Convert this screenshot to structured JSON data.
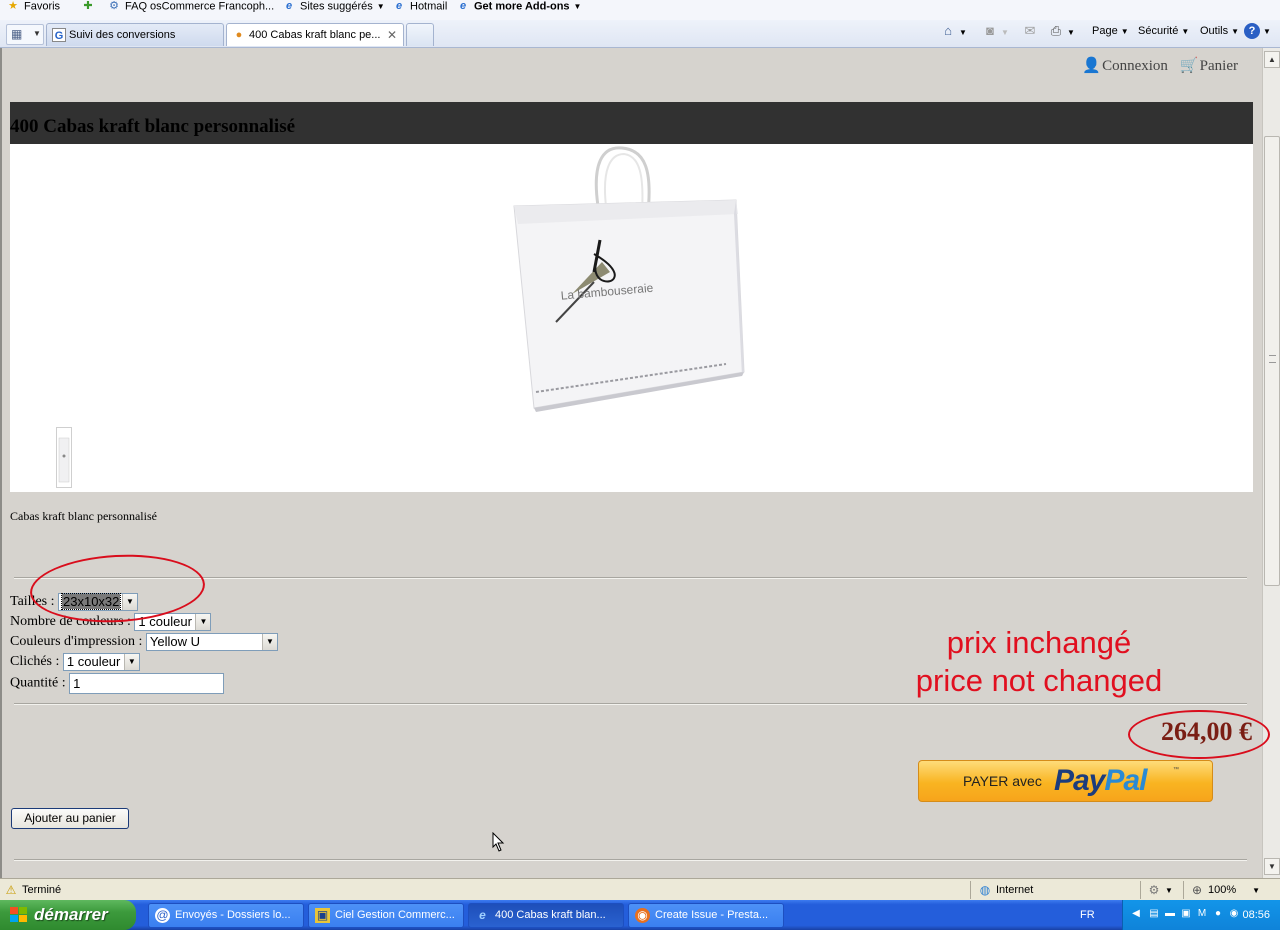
{
  "favorites_bar": {
    "items": [
      {
        "label": "Favoris",
        "icon": "star-icon"
      },
      {
        "label": "",
        "icon": "add-favorite-icon"
      },
      {
        "label": "FAQ osCommerce Francoph...",
        "icon": "link-icon"
      },
      {
        "label": "Sites suggérés",
        "icon": "ie-icon",
        "dropdown": true
      },
      {
        "label": "Hotmail",
        "icon": "ie-icon"
      },
      {
        "label": "Get more Add-ons",
        "icon": "ie-icon",
        "dropdown": true
      }
    ]
  },
  "tabs": [
    {
      "label": "Suivi des conversions",
      "icon": "google-icon",
      "active": false
    },
    {
      "label": "400 Cabas kraft blanc pe...",
      "icon": "page-icon",
      "active": true
    }
  ],
  "command_bar": {
    "page": "Page",
    "security": "Sécurité",
    "tools": "Outils"
  },
  "header_nav": {
    "login": "Connexion",
    "cart": "Panier"
  },
  "product": {
    "title": "400 Cabas kraft blanc personnalisé",
    "description": "Cabas kraft blanc personnalisé",
    "bag_text": "La bambouseraie",
    "options": [
      {
        "label": "Tailles :",
        "value": "23x10x32",
        "kind": "select"
      },
      {
        "label": "Nombre de couleurs :",
        "value": "1 couleur",
        "kind": "select"
      },
      {
        "label": "Couleurs d'impression :",
        "value": "Yellow U",
        "kind": "select"
      },
      {
        "label": "Clichés :",
        "value": "1 couleur",
        "kind": "select"
      },
      {
        "label": "Quantité :",
        "value": "1",
        "kind": "text"
      }
    ],
    "price": "264,00 €",
    "add_to_cart": "Ajouter au panier",
    "paypal": {
      "prefix": "PAYER avec",
      "brand_a": "Pay",
      "brand_b": "Pal",
      "tm": "™"
    }
  },
  "annotations": {
    "line1": "prix inchangé",
    "line2": "price not changed",
    "color": "#e10f1f"
  },
  "status_bar": {
    "status": "Terminé",
    "zone": "Internet",
    "zoom": "100%"
  },
  "taskbar": {
    "start": "démarrer",
    "tasks": [
      {
        "label": "Envoyés - Dossiers lo...",
        "active": false
      },
      {
        "label": "Ciel Gestion Commerc...",
        "active": false
      },
      {
        "label": "400 Cabas kraft blan...",
        "active": true
      },
      {
        "label": "Create Issue - Presta...",
        "active": false
      }
    ],
    "lang": "FR",
    "clock": "08:56"
  }
}
